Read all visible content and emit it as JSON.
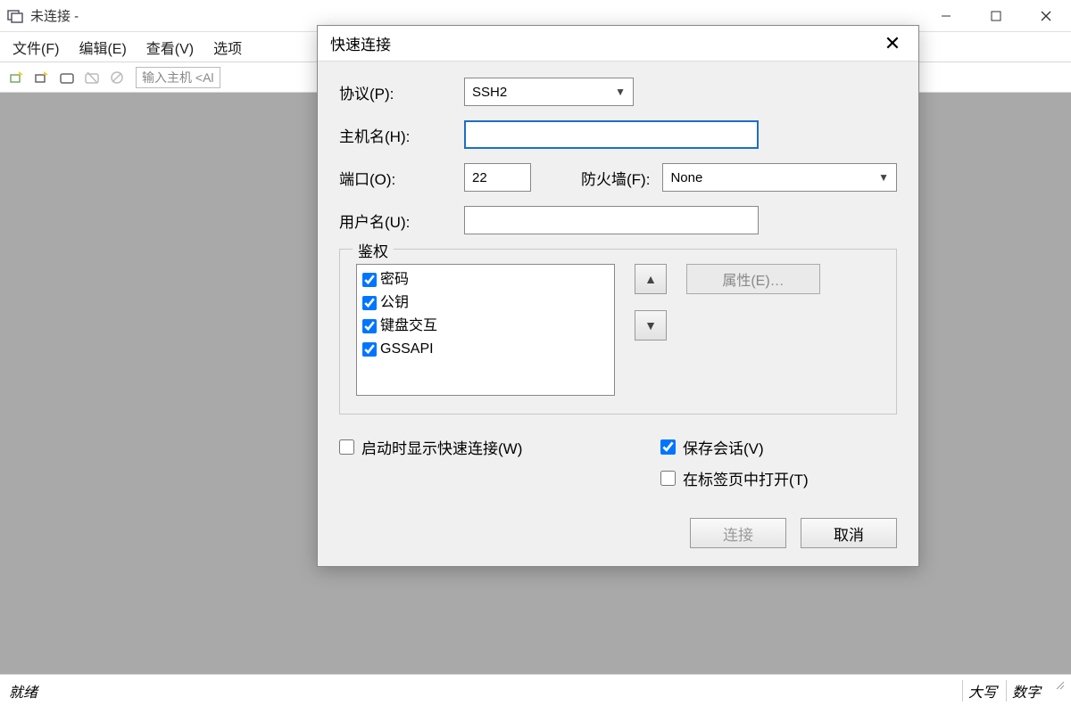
{
  "titlebar": {
    "title": "未连接 -"
  },
  "menubar": {
    "file": "文件(F)",
    "edit": "编辑(E)",
    "view": "查看(V)",
    "options": "选项"
  },
  "toolbar": {
    "host_placeholder": "输入主机 <Al"
  },
  "statusbar": {
    "left": "就绪",
    "caps": "大写",
    "num": "数字"
  },
  "dialog": {
    "title": "快速连接",
    "protocol_label": "协议(P):",
    "protocol_value": "SSH2",
    "hostname_label": "主机名(H):",
    "hostname_value": "",
    "port_label": "端口(O):",
    "port_value": "22",
    "firewall_label": "防火墙(F):",
    "firewall_value": "None",
    "username_label": "用户名(U):",
    "username_value": "",
    "auth_legend": "鉴权",
    "auth_items": [
      "密码",
      "公钥",
      "键盘交互",
      "GSSAPI"
    ],
    "properties_btn": "属性(E)…",
    "show_on_start": "启动时显示快速连接(W)",
    "save_session": "保存会话(V)",
    "open_in_tab": "在标签页中打开(T)",
    "connect_btn": "连接",
    "cancel_btn": "取消"
  }
}
